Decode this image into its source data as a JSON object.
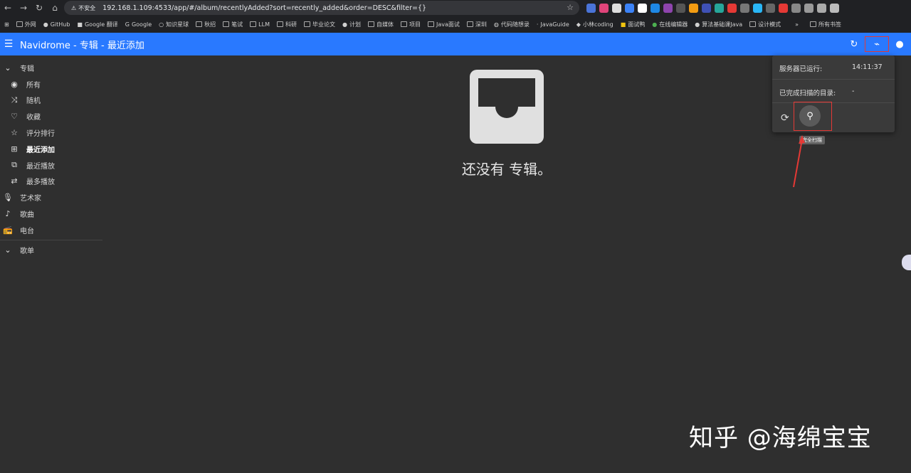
{
  "browser": {
    "insecure_label": "不安全",
    "url": "192.168.1.109:4533/app/#/album/recentlyAdded?sort=recently_added&order=DESC&filter={}",
    "bookmarks": [
      "外网",
      "GitHub",
      "Google 翻译",
      "Google",
      "知识星球",
      "秋招",
      "笔试",
      "LLM",
      "科研",
      "毕业论文",
      "计划",
      "自媒体",
      "项目",
      "Java面试",
      "深圳",
      "代码随想录",
      "JavaGuide",
      "小林coding",
      "面试鸭",
      "在线编辑器",
      "算法基础课Java",
      "设计模式"
    ],
    "bookmarks_more": "»",
    "all_bookmarks": "所有书签"
  },
  "appbar": {
    "title": "Navidrome - 专辑 - 最近添加"
  },
  "sidebar": {
    "items": [
      {
        "label": "专辑",
        "icon": "chevron-down-icon",
        "glyph": "⌄",
        "level": "top"
      },
      {
        "label": "所有",
        "icon": "album-icon",
        "glyph": "◉",
        "level": "sub"
      },
      {
        "label": "随机",
        "icon": "shuffle-icon",
        "glyph": "⤨",
        "level": "sub"
      },
      {
        "label": "收藏",
        "icon": "heart-icon",
        "glyph": "♡",
        "level": "sub"
      },
      {
        "label": "评分排行",
        "icon": "star-icon",
        "glyph": "☆",
        "level": "sub"
      },
      {
        "label": "最近添加",
        "icon": "library-add-icon",
        "glyph": "⊞",
        "level": "sub",
        "active": true
      },
      {
        "label": "最近播放",
        "icon": "video-library-icon",
        "glyph": "⧉",
        "level": "sub"
      },
      {
        "label": "最多播放",
        "icon": "repeat-icon",
        "glyph": "⇄",
        "level": "sub"
      },
      {
        "label": "艺术家",
        "icon": "microphone-icon",
        "glyph": "🎙",
        "level": "top"
      },
      {
        "label": "歌曲",
        "icon": "music-note-icon",
        "glyph": "♪",
        "level": "top"
      },
      {
        "label": "电台",
        "icon": "radio-icon",
        "glyph": "📻",
        "level": "top"
      },
      {
        "label": "歌单",
        "icon": "chevron-down-icon",
        "glyph": "⌄",
        "level": "top"
      }
    ]
  },
  "main": {
    "empty_text": "还没有 专辑。"
  },
  "activity_panel": {
    "uptime_label": "服务器已运行:",
    "uptime_value": "14:11:37",
    "scanned_label": "已完成扫描的目录:",
    "scanned_value": "-",
    "tooltip": "完全扫描"
  },
  "watermark": "知乎 @海绵宝宝",
  "colors": {
    "accent": "#2979ff",
    "background": "#2f2f2f",
    "annotation": "#e53935"
  }
}
